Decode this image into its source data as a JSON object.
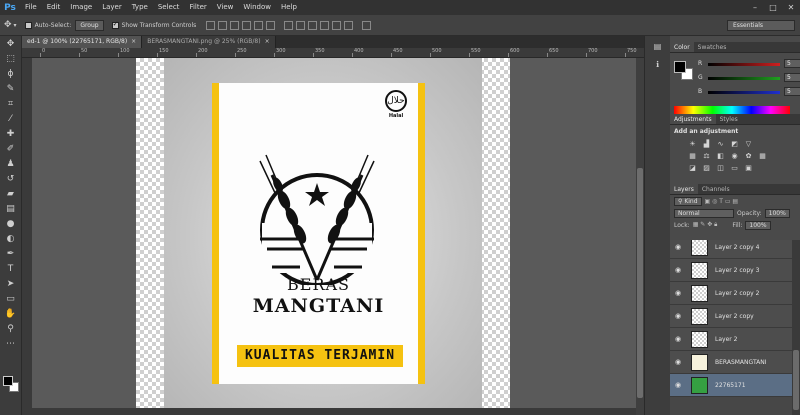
{
  "app": {
    "logo": "Ps"
  },
  "menu": [
    "File",
    "Edit",
    "Image",
    "Layer",
    "Type",
    "Select",
    "Filter",
    "View",
    "Window",
    "Help"
  ],
  "window_controls": {
    "minimize": "–",
    "maximize": "□",
    "close": "✕"
  },
  "options": {
    "auto_select_label": "Auto-Select:",
    "auto_select_value": "Group",
    "show_transform_label": "Show Transform Controls",
    "workspace": "Essentials"
  },
  "tabs": [
    {
      "label": "ed-1 @ 100% (22765171, RGB/8)",
      "close": "×"
    },
    {
      "label": "BERASMANGTANI.png @ 25% (RGB/8)",
      "close": "×"
    }
  ],
  "ruler_ticks": [
    "0",
    "50",
    "100",
    "150",
    "200",
    "250",
    "300",
    "350",
    "400",
    "450",
    "500",
    "550",
    "600",
    "650",
    "700",
    "750"
  ],
  "poster": {
    "halal_symbol": "حلال",
    "halal_label": "Halal",
    "brand_line1": "BERAS",
    "brand_line2": "MANGTANI",
    "tagline": "KUALITAS TERJAMIN"
  },
  "panels": {
    "color_tabs": [
      "Color",
      "Swatches"
    ],
    "sliders": [
      {
        "label": "R",
        "value": "5",
        "color": "#d02020"
      },
      {
        "label": "G",
        "value": "5",
        "color": "#20a020"
      },
      {
        "label": "B",
        "value": "5",
        "color": "#2030d0"
      }
    ],
    "adjust_tabs": [
      "Adjustments",
      "Styles"
    ],
    "adjust_title": "Add an adjustment",
    "layers_tabs": [
      "Layers",
      "Channels"
    ],
    "kind_label": "Kind",
    "blend_mode": "Normal",
    "opacity_label": "Opacity:",
    "opacity_value": "100%",
    "lock_label": "Lock:",
    "fill_label": "Fill:",
    "fill_value": "100%",
    "layers": [
      {
        "name": "Layer 2 copy 4",
        "thumb": "transparent",
        "selected": false
      },
      {
        "name": "Layer 2 copy 3",
        "thumb": "transparent",
        "selected": false
      },
      {
        "name": "Layer 2 copy 2",
        "thumb": "transparent",
        "selected": false
      },
      {
        "name": "Layer 2 copy",
        "thumb": "transparent",
        "selected": false
      },
      {
        "name": "Layer 2",
        "thumb": "transparent",
        "selected": false
      },
      {
        "name": "BERASMANGTANI",
        "thumb": "poster",
        "selected": false
      },
      {
        "name": "22765171",
        "thumb": "green",
        "selected": true
      }
    ]
  },
  "colors": {
    "accent_yellow": "#f5c211",
    "selection": "#5b6e85"
  }
}
